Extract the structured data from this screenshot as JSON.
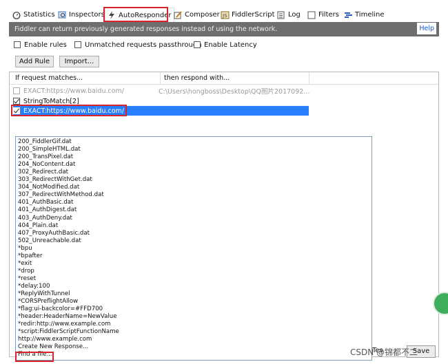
{
  "tabs": [
    {
      "label": "Statistics",
      "icon": "stopwatch-icon"
    },
    {
      "label": "Inspectors",
      "icon": "magnifier-icon"
    },
    {
      "label": "AutoResponder",
      "icon": "lightning-icon"
    },
    {
      "label": "Composer",
      "icon": "pencil-icon"
    },
    {
      "label": "FiddlerScript",
      "icon": "script-icon"
    },
    {
      "label": "Log",
      "icon": "log-icon"
    },
    {
      "label": "Filters",
      "icon": "checkbox-icon"
    },
    {
      "label": "Timeline",
      "icon": "timeline-icon"
    }
  ],
  "banner": {
    "message": "Fiddler can return previously generated responses instead of using the network.",
    "help": "Help"
  },
  "options": {
    "enable_rules": "Enable rules",
    "unmatched": "Unmatched requests passthrough",
    "latency": "Enable Latency"
  },
  "buttons": {
    "add_rule": "Add Rule",
    "import": "Import..."
  },
  "grid": {
    "col1": "If request matches...",
    "col2": "then respond with...",
    "rules": [
      {
        "match": "EXACT:https://www.baidu.com/",
        "respond": "C:\\Users\\hongboss\\Desktop\\QQ图片2017092...",
        "checked": false,
        "state": "disabled"
      },
      {
        "match": "StringToMatch[2]",
        "respond": "",
        "checked": true,
        "state": "normal"
      },
      {
        "match": "EXACT:https://www.baidu.com/",
        "respond": "",
        "checked": true,
        "state": "selected"
      }
    ]
  },
  "dropdown_items": [
    "200_FiddlerGif.dat",
    "200_SimpleHTML.dat",
    "200_TransPixel.dat",
    "204_NoContent.dat",
    "302_Redirect.dat",
    "303_RedirectWithGet.dat",
    "304_NotModified.dat",
    "307_RedirectWithMethod.dat",
    "401_AuthBasic.dat",
    "401_AuthDigest.dat",
    "403_AuthDeny.dat",
    "404_Plain.dat",
    "407_ProxyAuthBasic.dat",
    "502_Unreachable.dat",
    "*bpu",
    "*bpafter",
    "*exit",
    "*drop",
    "*reset",
    "*delay:100",
    "*ReplyWithTunnel",
    "*CORSPreflightAllow",
    "*flag:ui-backcolor=#FFD700",
    "*header:HeaderName=NewValue",
    "*redir:http://www.example.com",
    "*script:FiddlerScriptFunctionName",
    "http://www.example.com",
    "Create New Response...",
    "Find a file..."
  ],
  "bottom": {
    "test_label": "Tes",
    "save_label": "Save"
  },
  "watermark": "CSDN @锦都不二",
  "colors": {
    "highlight": "#d9222a",
    "selection": "#2a7fff",
    "banner": "#6e6e6e"
  }
}
